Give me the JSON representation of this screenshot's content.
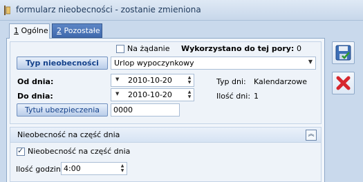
{
  "window": {
    "title": "formularz nieobecności - zostanie zmieniona"
  },
  "tabs": [
    {
      "num": "1",
      "label": "Ogólne"
    },
    {
      "num": "2",
      "label": "Pozostałe"
    }
  ],
  "form": {
    "on_demand_label": "Na żądanie",
    "on_demand_checked": false,
    "used_label": "Wykorzystano do tej pory:",
    "used_value": "0",
    "absence_type_button": "Typ nieobecności",
    "absence_type_value": "Urlop wypoczynkowy",
    "from_label": "Od dnia:",
    "from_value": "2010-10-20",
    "to_label": "Do dnia:",
    "to_value": "2010-10-20",
    "day_type_label": "Typ dni:",
    "day_type_value": "Kalendarzowe",
    "days_count_label": "Ilość dni:",
    "days_count_value": "1",
    "insurance_title_button": "Tytuł ubezpieczenia",
    "insurance_title_value": "0000"
  },
  "partial_day": {
    "header": "Nieobecność na część dnia",
    "checkbox_label": "Nieobecność na część dnia",
    "checkbox_checked": true,
    "hours_label": "Ilość godzin:",
    "hours_value": "4:00"
  },
  "icons": {
    "save": "save-icon",
    "cancel": "cancel-icon",
    "app": "app-icon",
    "collapse": "collapse-up-icon"
  },
  "colors": {
    "accent": "#3f69ad",
    "cancel_red": "#d6262d",
    "title_text": "#1e395b"
  }
}
